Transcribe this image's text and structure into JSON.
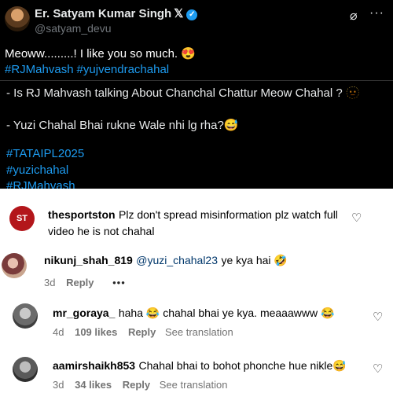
{
  "tweet": {
    "author": "Er. Satyam Kumar Singh",
    "author_suffix": "𝕏",
    "verified_glyph": "✓",
    "handle": "@satyam_devu",
    "grok_glyph": "⌀",
    "more_glyph": "···",
    "text": "Meoww.........! I like you so much. 😍",
    "hashtags": [
      "#RJMahvash",
      "#yujvendrachahal"
    ]
  },
  "quoted": {
    "line1": "- Is RJ Mahvash talking About Chanchal Chattur Meow Chahal ? 🫥",
    "line2": "- Yuzi Chahal Bhai rukne Wale nhi lg rha?😅",
    "tags": [
      "#TATAIPL2025",
      "#yuzichahal",
      "#RJMahvash"
    ]
  },
  "comments": [
    {
      "avatar_text": "ST",
      "user": "thesportston",
      "text_line1": "Plz don't spread misinformation plz watch full",
      "text_line2": "video he is not chahal"
    },
    {
      "user": "nikunj_shah_819",
      "mention": "@yuzi_chahal23",
      "text": "ye kya hai 🤣",
      "age": "3d",
      "reply": "Reply",
      "more": "•••"
    },
    {
      "user": "mr_goraya_",
      "text": "haha 😂 chahal bhai ye kya. meaaawww 😂",
      "age": "4d",
      "likes": "109 likes",
      "reply": "Reply",
      "translate": "See translation"
    },
    {
      "user": "aamirshaikh853",
      "text": "Chahal bhai to bohot phonche hue nikle😅",
      "age": "3d",
      "likes": "34 likes",
      "reply": "Reply",
      "translate": "See translation"
    }
  ],
  "heart_glyph": "♡",
  "colors": {
    "accent": "#1d9bf0",
    "meta": "#737373",
    "st_red": "#b3161b"
  }
}
